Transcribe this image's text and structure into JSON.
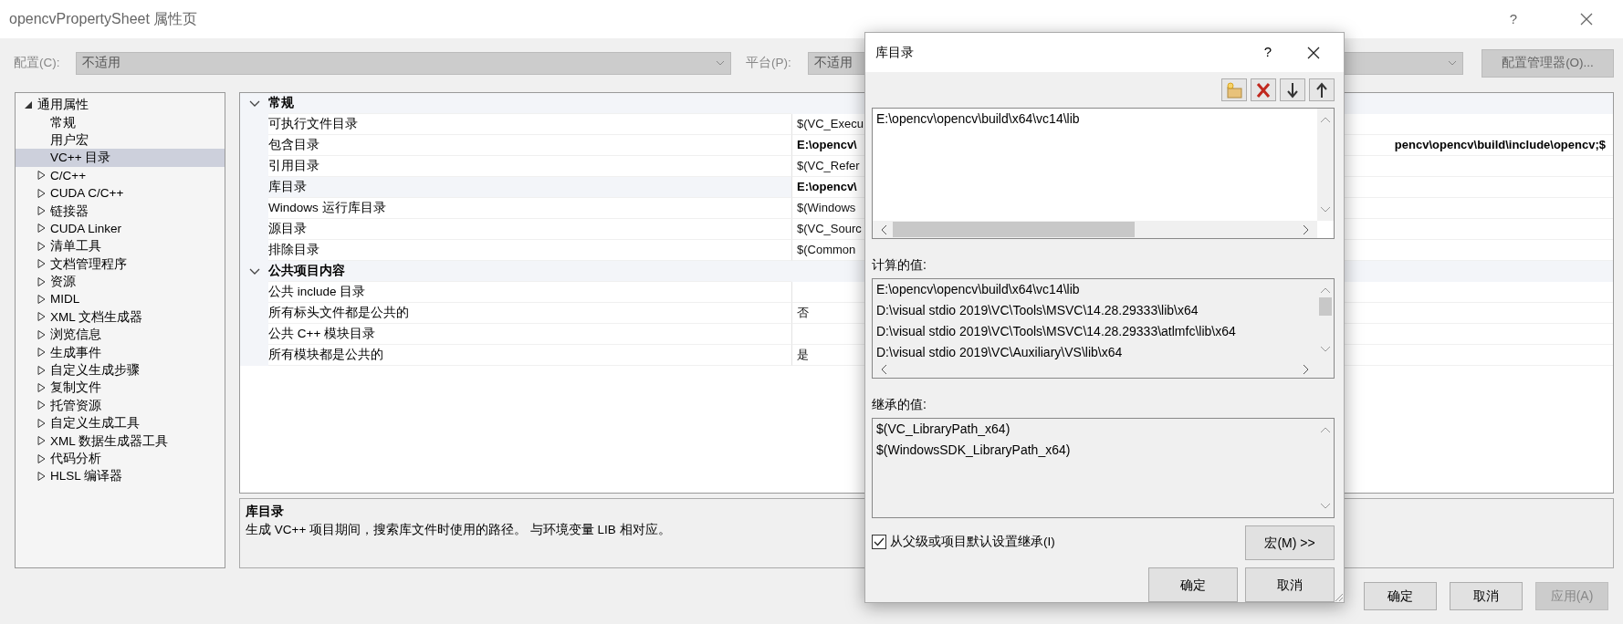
{
  "window": {
    "title": "opencvPropertySheet 属性页",
    "help": "?"
  },
  "config": {
    "label": "配置(C):",
    "value": "不适用"
  },
  "platform": {
    "label": "平台(P):",
    "value": "不适用"
  },
  "config_manager": {
    "label": "配置管理器(O)...",
    "disabled": true
  },
  "tree": [
    {
      "label": "通用属性",
      "expanded": true,
      "selected": false,
      "children": [
        {
          "label": "常规",
          "selected": false
        },
        {
          "label": "用户宏",
          "selected": false
        },
        {
          "label": "VC++ 目录",
          "selected": true
        }
      ]
    },
    {
      "label": "C/C++",
      "expanded": false,
      "selected": false
    },
    {
      "label": "CUDA C/C++",
      "expanded": false,
      "selected": false
    },
    {
      "label": "链接器",
      "expanded": false,
      "selected": false
    },
    {
      "label": "CUDA Linker",
      "expanded": false,
      "selected": false
    },
    {
      "label": "清单工具",
      "expanded": false,
      "selected": false
    },
    {
      "label": "文档管理程序",
      "expanded": false,
      "selected": false
    },
    {
      "label": "资源",
      "expanded": false,
      "selected": false
    },
    {
      "label": "MIDL",
      "expanded": false,
      "selected": false
    },
    {
      "label": "XML 文档生成器",
      "expanded": false,
      "selected": false
    },
    {
      "label": "浏览信息",
      "expanded": false,
      "selected": false
    },
    {
      "label": "生成事件",
      "expanded": false,
      "selected": false
    },
    {
      "label": "自定义生成步骤",
      "expanded": false,
      "selected": false
    },
    {
      "label": "复制文件",
      "expanded": false,
      "selected": false
    },
    {
      "label": "托管资源",
      "expanded": false,
      "selected": false
    },
    {
      "label": "自定义生成工具",
      "expanded": false,
      "selected": false
    },
    {
      "label": "XML 数据生成器工具",
      "expanded": false,
      "selected": false
    },
    {
      "label": "代码分析",
      "expanded": false,
      "selected": false
    },
    {
      "label": "HLSL 编译器",
      "expanded": false,
      "selected": false
    }
  ],
  "grid": [
    {
      "title": "常规",
      "expanded": true,
      "rows": [
        {
          "name": "可执行文件目录",
          "value": "$(VC_Execu",
          "bold": false,
          "selected": false
        },
        {
          "name": "包含目录",
          "value": "E:\\opencv\\",
          "value_tail": "pencv\\opencv\\build\\include\\opencv;$",
          "bold": true,
          "selected": false
        },
        {
          "name": "引用目录",
          "value": "$(VC_Refer",
          "bold": false,
          "selected": false
        },
        {
          "name": "库目录",
          "value": "E:\\opencv\\",
          "bold": true,
          "selected": true
        },
        {
          "name": "Windows 运行库目录",
          "value": "$(Windows",
          "bold": false,
          "selected": false
        },
        {
          "name": "源目录",
          "value": "$(VC_Sourc",
          "bold": false,
          "selected": false
        },
        {
          "name": "排除目录",
          "value": "$(Common",
          "bold": false,
          "selected": false
        }
      ]
    },
    {
      "title": "公共项目内容",
      "expanded": true,
      "rows": [
        {
          "name": "公共 include 目录",
          "selected": false
        },
        {
          "name": "所有标头文件都是公共的",
          "value": "否",
          "bold": false,
          "selected": false
        },
        {
          "name": "公共 C++ 模块目录",
          "selected": false
        },
        {
          "name": "所有模块都是公共的",
          "value": "是",
          "bold": false,
          "selected": false
        }
      ]
    }
  ],
  "description": {
    "title": "库目录",
    "text": "生成 VC++ 项目期间，搜索库文件时使用的路径。 与环境变量 LIB 相对应。"
  },
  "buttons": [
    {
      "label": "确定",
      "disabled": false
    },
    {
      "label": "取消",
      "disabled": false
    },
    {
      "label": "应用(A)",
      "disabled": true
    }
  ],
  "dialog": {
    "title": "库目录",
    "help": "?",
    "entries": [
      "E:\\opencv\\opencv\\build\\x64\\vc14\\lib"
    ],
    "computed_label": "计算的值:",
    "computed": [
      "E:\\opencv\\opencv\\build\\x64\\vc14\\lib",
      "D:\\visual stdio 2019\\VC\\Tools\\MSVC\\14.28.29333\\lib\\x64",
      "D:\\visual stdio 2019\\VC\\Tools\\MSVC\\14.28.29333\\atlmfc\\lib\\x64",
      "D:\\visual stdio 2019\\VC\\Auxiliary\\VS\\lib\\x64"
    ],
    "inherited_label": "继承的值:",
    "inherited": [
      "$(VC_LibraryPath_x64)",
      "$(WindowsSDK_LibraryPath_x64)"
    ],
    "inherit": {
      "label": "从父级或项目默认设置继承(I)",
      "checked": true
    },
    "macro_button": "宏(M) >>",
    "buttons": [
      {
        "label": "确定"
      },
      {
        "label": "取消"
      }
    ]
  }
}
